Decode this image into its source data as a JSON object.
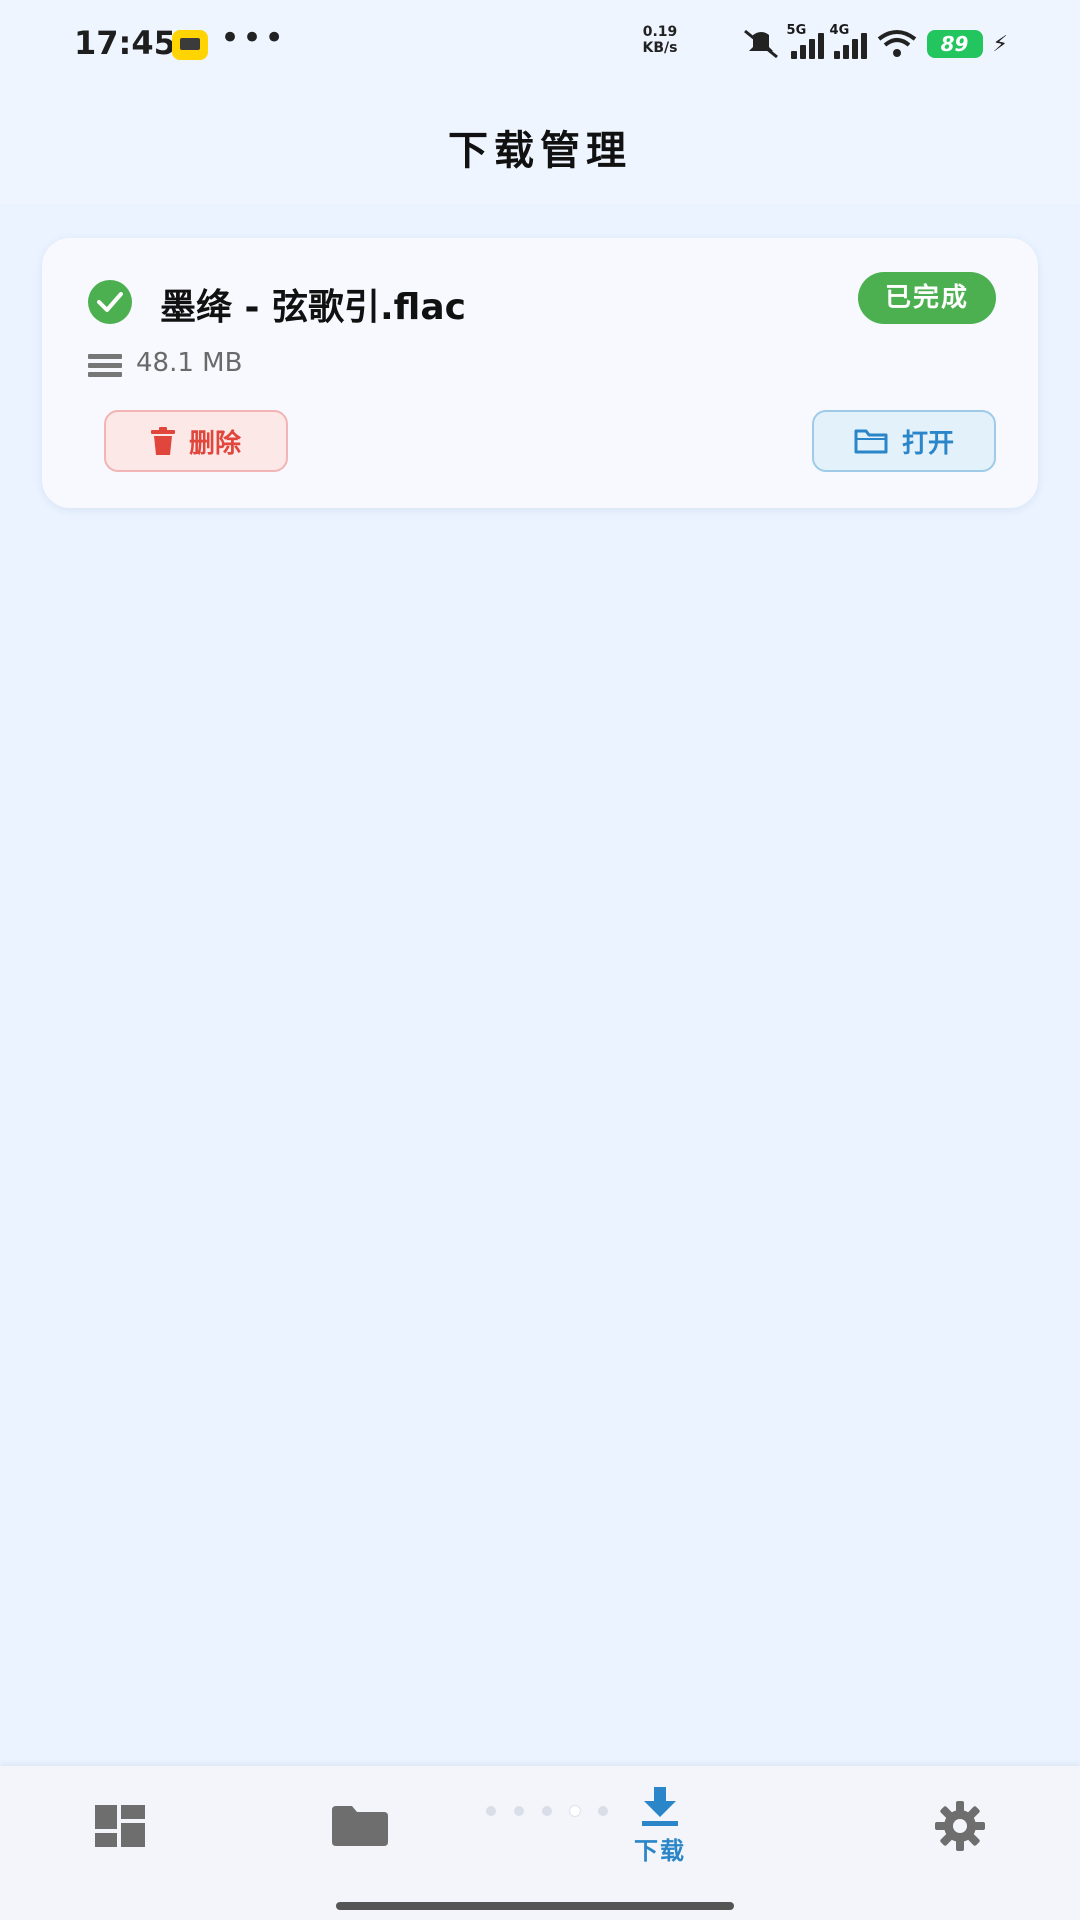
{
  "status_bar": {
    "time": "17:45",
    "more": "•••",
    "speed_value": "0.19",
    "speed_unit": "KB/s",
    "signal1": "5G",
    "signal2": "4G",
    "battery": "89",
    "icons": [
      "app-badge-icon",
      "mute-icon",
      "signal-5g-icon",
      "signal-4g-icon",
      "wifi-icon",
      "battery-icon",
      "charging-icon"
    ]
  },
  "header": {
    "title": "下载管理"
  },
  "download_item": {
    "name": "墨绛 - 弦歌引.flac",
    "size": "48.1 MB",
    "status": "已完成",
    "delete_label": "删除",
    "open_label": "打开"
  },
  "bottom_nav": {
    "items": [
      {
        "icon": "dashboard-icon",
        "label": ""
      },
      {
        "icon": "folder-icon",
        "label": ""
      },
      {
        "icon": "download-icon",
        "label": "下载",
        "active": true
      },
      {
        "icon": "settings-icon",
        "label": ""
      }
    ]
  },
  "colors": {
    "accent": "#2b86c9",
    "success": "#4caf50",
    "danger": "#e0463c",
    "background": "#eaf3ff"
  }
}
